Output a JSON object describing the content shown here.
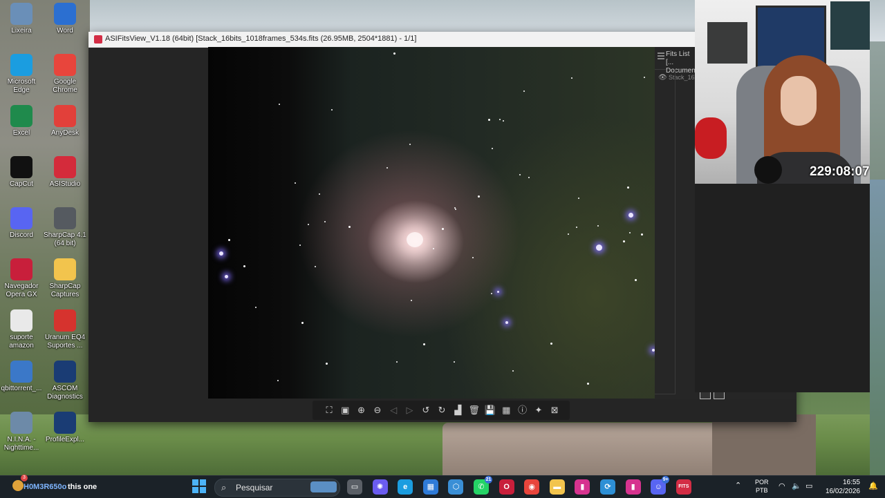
{
  "desktop": {
    "icons": [
      {
        "label": "Lixeira",
        "icon": "recycle-bin-icon",
        "color": "#6a8fb8"
      },
      {
        "label": "Word",
        "icon": "word-icon",
        "color": "#2b6fd1"
      },
      {
        "label": "Microsoft Edge",
        "icon": "edge-icon",
        "color": "#1b9de0"
      },
      {
        "label": "Google Chrome",
        "icon": "chrome-icon",
        "color": "#e8453c"
      },
      {
        "label": "Excel",
        "icon": "excel-icon",
        "color": "#1f8a4c"
      },
      {
        "label": "AnyDesk",
        "icon": "anydesk-icon",
        "color": "#e2403a"
      },
      {
        "label": "CapCut",
        "icon": "capcut-icon",
        "color": "#111111"
      },
      {
        "label": "ASIStudio",
        "icon": "asistudio-icon",
        "color": "#d42b3b"
      },
      {
        "label": "Discord",
        "icon": "discord-icon",
        "color": "#5865f2"
      },
      {
        "label": "SharpCap 4.1 (64 bit)",
        "icon": "sharpcap-icon",
        "color": "#555a60"
      },
      {
        "label": "Navegador Opera GX",
        "icon": "opera-gx-icon",
        "color": "#c81f3b"
      },
      {
        "label": "SharpCap Captures",
        "icon": "folder-icon",
        "color": "#f2c44d"
      },
      {
        "label": "suporte amazon",
        "icon": "document-icon",
        "color": "#e9e9e9"
      },
      {
        "label": "Uranum EQ4 Suportes ...",
        "icon": "pdf-icon",
        "color": "#d6332e"
      },
      {
        "label": "qbittorrent_...",
        "icon": "installer-icon",
        "color": "#3b78c8"
      },
      {
        "label": "ASCOM Diagnostics",
        "icon": "ascom-icon",
        "color": "#1a3c74"
      },
      {
        "label": "N.I.N.A. - Nighttime...",
        "icon": "nina-icon",
        "color": "#6d8aa8"
      },
      {
        "label": "ProfileExpl...",
        "icon": "ascom-profile-icon",
        "color": "#1a3c74"
      }
    ]
  },
  "fits_window": {
    "title": "ASIFitsView_V1.18 (64bit) [Stack_16bits_1018frames_534s.fits (26.95MB, 2504*1881) - 1/1]",
    "side_panel": {
      "header": "Fits List [... Documen...",
      "file_item": "Stack_16"
    },
    "toolbar": [
      {
        "name": "fit-to-window-icon",
        "glyph": "⛶"
      },
      {
        "name": "actual-size-icon",
        "glyph": "▣"
      },
      {
        "name": "zoom-in-icon",
        "glyph": "⊕"
      },
      {
        "name": "zoom-out-icon",
        "glyph": "⊖"
      },
      {
        "name": "previous-icon",
        "glyph": "◁"
      },
      {
        "name": "next-icon",
        "glyph": "▷"
      },
      {
        "name": "rotate-left-icon",
        "glyph": "↺"
      },
      {
        "name": "rotate-right-icon",
        "glyph": "↻"
      },
      {
        "name": "histogram-icon",
        "glyph": "▟"
      },
      {
        "name": "delete-icon",
        "glyph": "🗑"
      },
      {
        "name": "save-icon",
        "glyph": "💾"
      },
      {
        "name": "debayer-icon",
        "glyph": "▦"
      },
      {
        "name": "info-icon",
        "glyph": "ⓘ"
      },
      {
        "name": "star-detect-icon",
        "glyph": "✦"
      },
      {
        "name": "crop-icon",
        "glyph": "⊠"
      }
    ]
  },
  "webcam": {
    "timer": "229:08:07"
  },
  "taskbar": {
    "notification_count": "3",
    "chat_user": "H0M3R650o",
    "chat_message": "this one",
    "search_placeholder": "Pesquisar",
    "apps": [
      {
        "name": "file-manager-icon",
        "color": "#5a5f66",
        "glyph": "▭"
      },
      {
        "name": "copilot-icon",
        "color": "#6b5cf0",
        "glyph": "✺"
      },
      {
        "name": "edge-taskbar-icon",
        "color": "#1b9de0",
        "glyph": "e"
      },
      {
        "name": "store-icon",
        "color": "#2f7bd8",
        "glyph": "▦"
      },
      {
        "name": "vscode-like-icon",
        "color": "#3a8fd6",
        "glyph": "⬡"
      },
      {
        "name": "whatsapp-icon",
        "color": "#25d366",
        "glyph": "✆",
        "count": "21"
      },
      {
        "name": "opera-icon",
        "color": "#c81f3b",
        "glyph": "O"
      },
      {
        "name": "chrome-taskbar-icon",
        "color": "#e8453c",
        "glyph": "◉"
      },
      {
        "name": "folder-taskbar-icon",
        "color": "#f2c44d",
        "glyph": "▬"
      },
      {
        "name": "pink-app-icon",
        "color": "#d6338f",
        "glyph": "▮"
      },
      {
        "name": "sync-app-icon",
        "color": "#2d8fd5",
        "glyph": "⟳"
      },
      {
        "name": "pink-app2-icon",
        "color": "#d6338f",
        "glyph": "▮"
      },
      {
        "name": "discord-taskbar-icon",
        "color": "#5865f2",
        "glyph": "☺",
        "count": "9+"
      },
      {
        "name": "fits-taskbar-icon",
        "color": "#d32d45",
        "glyph": "FITS"
      }
    ],
    "language": {
      "line1": "POR",
      "line2": "PTB"
    },
    "time": "16:55",
    "date": "16/02/2026"
  }
}
